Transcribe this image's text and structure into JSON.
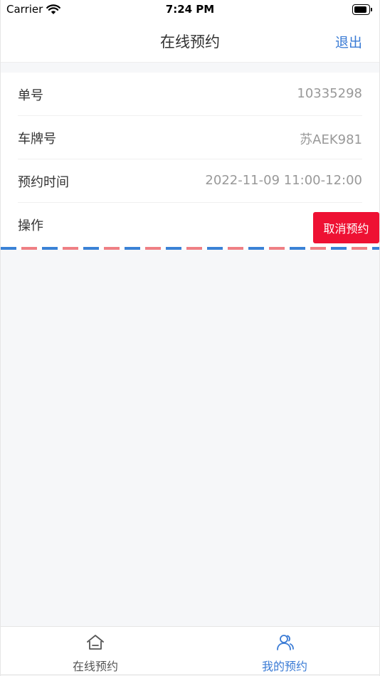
{
  "status_bar": {
    "carrier": "Carrier",
    "time": "7:24 PM"
  },
  "nav": {
    "title": "在线预约",
    "logout_label": "退出"
  },
  "detail": {
    "rows": [
      {
        "label": "单号",
        "value": "10335298"
      },
      {
        "label": "车牌号",
        "value": "苏AEK981"
      },
      {
        "label": "预约时间",
        "value": "2022-11-09 11:00-12:00"
      },
      {
        "label": "操作",
        "value": ""
      }
    ],
    "cancel_label": "取消预约"
  },
  "tabs": [
    {
      "label": "在线预约",
      "icon": "home-icon",
      "active": false
    },
    {
      "label": "我的预约",
      "icon": "users-icon",
      "active": true
    }
  ],
  "colors": {
    "accent": "#3a7bd5",
    "danger": "#ee1133",
    "airmail_blue": "#3a82d6",
    "airmail_red": "#ef7f84"
  }
}
